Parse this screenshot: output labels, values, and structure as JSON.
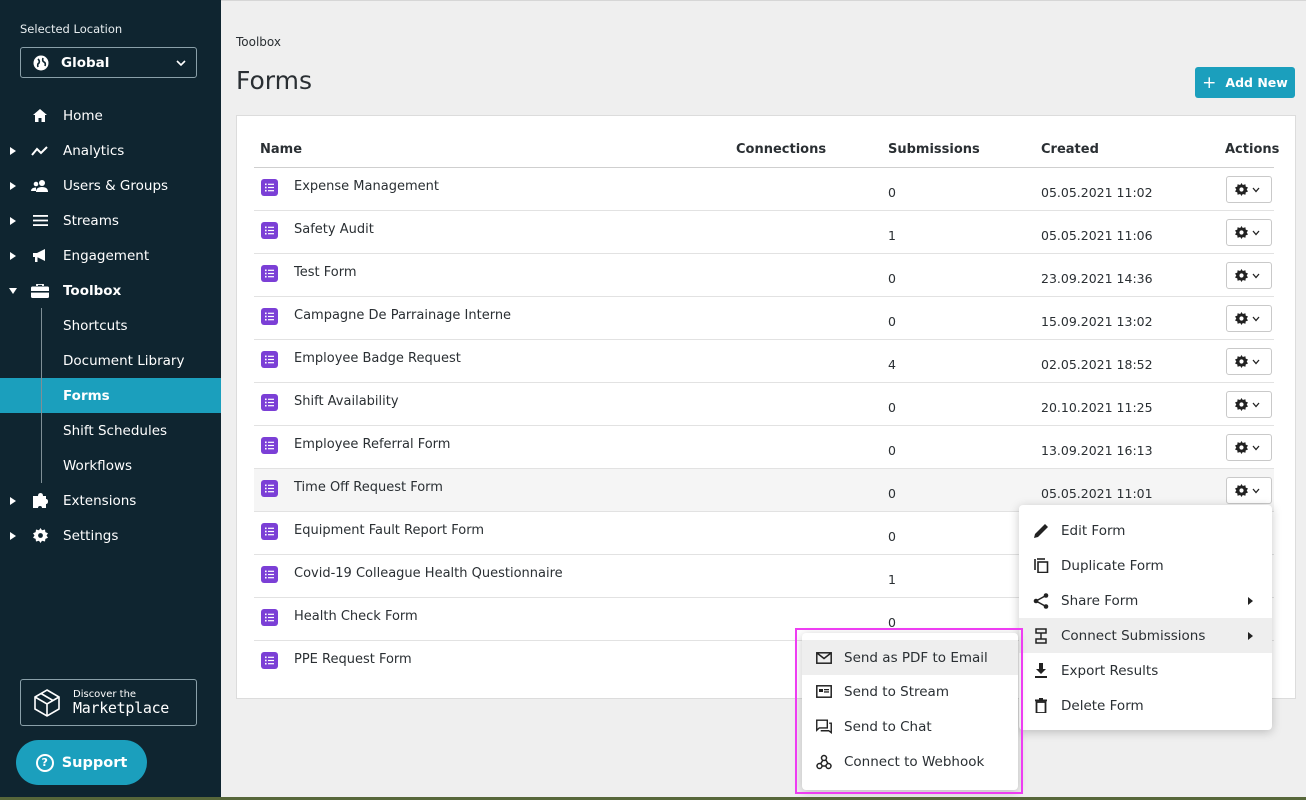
{
  "sidebar": {
    "selected_location_label": "Selected Location",
    "location_value": "Global",
    "nav": [
      {
        "label": "Home",
        "icon": "home-icon",
        "caret": false
      },
      {
        "label": "Analytics",
        "icon": "analytics-icon",
        "caret": true
      },
      {
        "label": "Users & Groups",
        "icon": "users-icon",
        "caret": true
      },
      {
        "label": "Streams",
        "icon": "streams-icon",
        "caret": true
      },
      {
        "label": "Engagement",
        "icon": "megaphone-icon",
        "caret": true
      },
      {
        "label": "Toolbox",
        "icon": "toolbox-icon",
        "caret": true,
        "expanded": true
      },
      {
        "label": "Extensions",
        "icon": "puzzle-icon",
        "caret": true
      },
      {
        "label": "Settings",
        "icon": "gear-icon",
        "caret": true
      }
    ],
    "toolbox_sub": [
      "Shortcuts",
      "Document Library",
      "Forms",
      "Shift Schedules",
      "Workflows"
    ],
    "active_sub": "Forms",
    "marketplace_line1": "Discover the",
    "marketplace_line2": "Marketplace",
    "support_label": "Support"
  },
  "header": {
    "breadcrumb": "Toolbox",
    "title": "Forms",
    "add_new_label": "Add New"
  },
  "table": {
    "columns": {
      "name": "Name",
      "connections": "Connections",
      "submissions": "Submissions",
      "created": "Created",
      "actions": "Actions"
    },
    "rows": [
      {
        "name": "Expense Management",
        "submissions": "0",
        "created": "05.05.2021 11:02"
      },
      {
        "name": "Safety Audit",
        "submissions": "1",
        "created": "05.05.2021 11:06"
      },
      {
        "name": "Test Form",
        "submissions": "0",
        "created": "23.09.2021 14:36"
      },
      {
        "name": "Campagne De Parrainage Interne",
        "submissions": "0",
        "created": "15.09.2021 13:02"
      },
      {
        "name": "Employee Badge Request",
        "submissions": "4",
        "created": "02.05.2021 18:52"
      },
      {
        "name": "Shift Availability",
        "submissions": "0",
        "created": "20.10.2021 11:25"
      },
      {
        "name": "Employee Referral Form",
        "submissions": "0",
        "created": "13.09.2021 16:13"
      },
      {
        "name": "Time Off Request Form",
        "submissions": "0",
        "created": "05.05.2021 11:01"
      },
      {
        "name": "Equipment Fault Report Form",
        "submissions": "0",
        "created": ""
      },
      {
        "name": "Covid-19 Colleague Health Questionnaire",
        "submissions": "1",
        "created": ""
      },
      {
        "name": "Health Check Form",
        "submissions": "0",
        "created": ""
      },
      {
        "name": "PPE Request Form",
        "submissions": "",
        "created": ""
      }
    ]
  },
  "actions_menu": {
    "items": [
      {
        "label": "Edit Form",
        "icon": "pencil-icon"
      },
      {
        "label": "Duplicate Form",
        "icon": "duplicate-icon"
      },
      {
        "label": "Share Form",
        "icon": "share-icon",
        "submenu": true
      },
      {
        "label": "Connect Submissions",
        "icon": "connect-icon",
        "submenu": true
      },
      {
        "label": "Export Results",
        "icon": "download-icon"
      },
      {
        "label": "Delete Form",
        "icon": "trash-icon"
      }
    ]
  },
  "connect_submenu": {
    "items": [
      {
        "label": "Send as PDF to Email",
        "icon": "mail-icon"
      },
      {
        "label": "Send to Stream",
        "icon": "stream-icon"
      },
      {
        "label": "Send to Chat",
        "icon": "chat-icon"
      },
      {
        "label": "Connect to Webhook",
        "icon": "webhook-icon"
      }
    ]
  },
  "colors": {
    "sidebar_bg": "#0f2530",
    "accent": "#1b9fbd",
    "form_icon": "#7b3fd6",
    "highlight_box": "#ee3df2"
  }
}
